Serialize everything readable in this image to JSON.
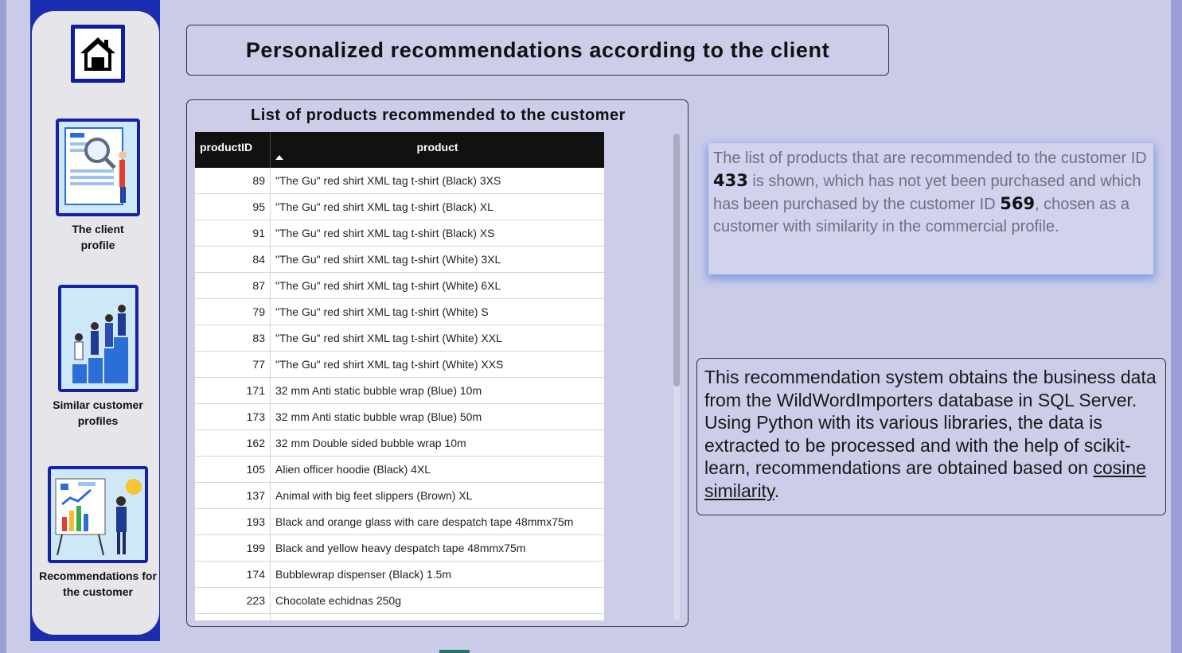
{
  "nav": {
    "home_label": "",
    "items": [
      {
        "label": "The client profile"
      },
      {
        "label": "Similar customer profiles"
      },
      {
        "label": "Recommendations for the customer"
      }
    ]
  },
  "header": {
    "title": "Personalized recommendations according to the client"
  },
  "table": {
    "title": "List of products recommended to the customer",
    "columns": [
      "productID",
      "product"
    ],
    "rows": [
      {
        "id": "89",
        "product": "\"The Gu\" red shirt XML tag t-shirt (Black) 3XS"
      },
      {
        "id": "95",
        "product": "\"The Gu\" red shirt XML tag t-shirt (Black) XL"
      },
      {
        "id": "91",
        "product": "\"The Gu\" red shirt XML tag t-shirt (Black) XS"
      },
      {
        "id": "84",
        "product": "\"The Gu\" red shirt XML tag t-shirt (White) 3XL"
      },
      {
        "id": "87",
        "product": "\"The Gu\" red shirt XML tag t-shirt (White) 6XL"
      },
      {
        "id": "79",
        "product": "\"The Gu\" red shirt XML tag t-shirt (White) S"
      },
      {
        "id": "83",
        "product": "\"The Gu\" red shirt XML tag t-shirt (White) XXL"
      },
      {
        "id": "77",
        "product": "\"The Gu\" red shirt XML tag t-shirt (White) XXS"
      },
      {
        "id": "171",
        "product": "32 mm Anti static bubble wrap (Blue) 10m"
      },
      {
        "id": "173",
        "product": "32 mm Anti static bubble wrap (Blue) 50m"
      },
      {
        "id": "162",
        "product": "32 mm Double sided bubble wrap 10m"
      },
      {
        "id": "105",
        "product": "Alien officer hoodie (Black) 4XL"
      },
      {
        "id": "137",
        "product": "Animal with big feet slippers (Brown) XL"
      },
      {
        "id": "193",
        "product": "Black and orange glass with care despatch tape 48mmx75m"
      },
      {
        "id": "199",
        "product": "Black and yellow heavy despatch tape 48mmx75m"
      },
      {
        "id": "174",
        "product": "Bubblewrap dispenser (Black) 1.5m"
      },
      {
        "id": "223",
        "product": "Chocolate echidnas 250g"
      },
      {
        "id": "",
        "product": ""
      }
    ]
  },
  "info": {
    "part1": "The list of products that are recommended to the customer ID ",
    "customer_id": "433",
    "part2": " is shown, which has not yet been purchased and which has been purchased by the customer ID ",
    "similar_id": "569",
    "part3": ", chosen as a customer with similarity in the commercial profile."
  },
  "description": {
    "text": "This recommendation system obtains the business data from the WildWordImporters database in SQL Server. Using Python with its various libraries, the data is extracted to be processed and with the help of scikit-learn, recommendations are obtained based on ",
    "link": "cosine similarity",
    "end": "."
  },
  "colors": {
    "background": "#c9cbe8",
    "sidebar": "#1a2db0",
    "accent_shadow": "#7f9be4"
  }
}
